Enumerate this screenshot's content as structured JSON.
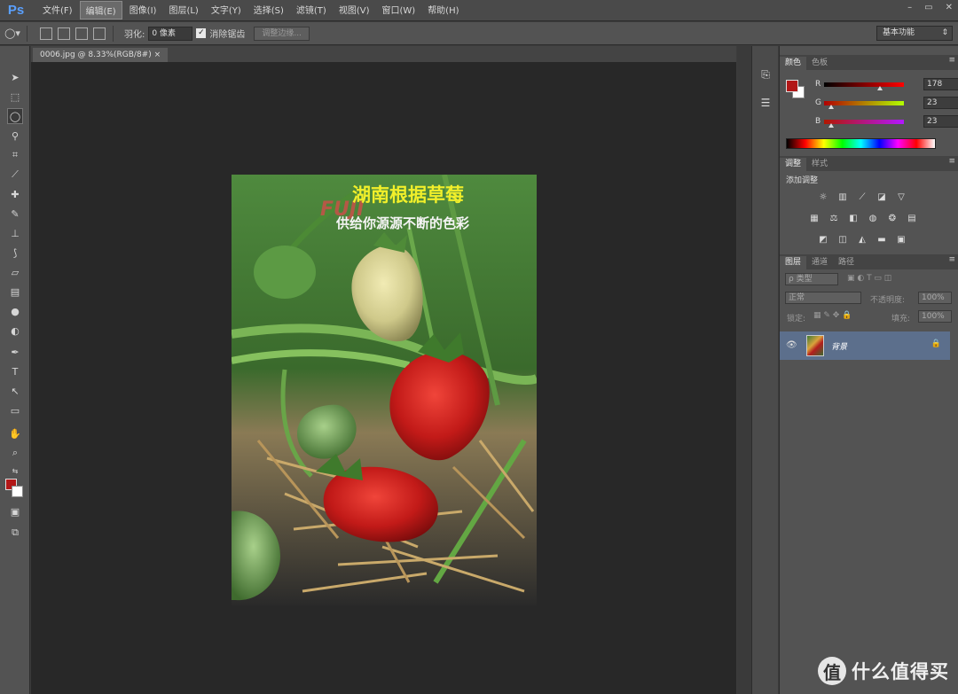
{
  "app": {
    "logo": "Ps"
  },
  "menu": [
    {
      "label": "文件(F)"
    },
    {
      "label": "编辑(E)",
      "active": true
    },
    {
      "label": "图像(I)"
    },
    {
      "label": "图层(L)"
    },
    {
      "label": "文字(Y)"
    },
    {
      "label": "选择(S)"
    },
    {
      "label": "滤镜(T)"
    },
    {
      "label": "视图(V)"
    },
    {
      "label": "窗口(W)"
    },
    {
      "label": "帮助(H)"
    }
  ],
  "window_controls": {
    "minimize": "–",
    "restore": "▭",
    "close": "✕"
  },
  "options": {
    "feather_label": "羽化:",
    "feather_value": "0 像素",
    "antialias_label": "消除锯齿",
    "refine_edge_label": "调整边缘...",
    "workspace": "基本功能"
  },
  "document": {
    "tab_title": "0006.jpg @ 8.33%(RGB/8#)"
  },
  "image": {
    "title_line1": "湖南根据草莓",
    "title_line2": "供给你源源不断的色彩",
    "logo_text": "FUJI"
  },
  "color_panel": {
    "tabs": [
      "颜色",
      "色板"
    ],
    "fg_color": "#b21717",
    "bg_color": "#ffffff",
    "channels": [
      {
        "label": "R",
        "value": "178",
        "gradient": "linear-gradient(90deg,#000,#f00)",
        "pos": 0.7
      },
      {
        "label": "G",
        "value": "23",
        "gradient": "linear-gradient(90deg,#b20000,#b2ff00)",
        "pos": 0.09
      },
      {
        "label": "B",
        "value": "23",
        "gradient": "linear-gradient(90deg,#b21700,#b217ff)",
        "pos": 0.09
      }
    ]
  },
  "adjustments": {
    "tabs": [
      "调整",
      "样式"
    ],
    "title": "添加调整"
  },
  "layers": {
    "tabs": [
      "图层",
      "通道",
      "路径"
    ],
    "kind_label": "ρ 类型",
    "blend_mode": "正常",
    "opacity_label": "不透明度:",
    "opacity_value": "100%",
    "lock_label": "锁定:",
    "fill_label": "填充:",
    "fill_value": "100%",
    "items": [
      {
        "name": "背景"
      }
    ]
  },
  "watermark": {
    "text": "什么值得买",
    "icon": "值"
  }
}
